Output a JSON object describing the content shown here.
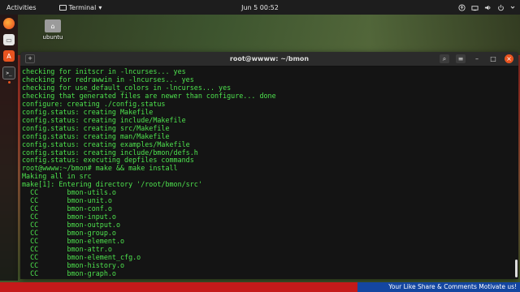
{
  "topbar": {
    "activities": "Activities",
    "app_name": "Terminal",
    "app_arrow": "▾",
    "clock": "Jun 5  00:52",
    "tray_icons": [
      "accessibility-icon",
      "network-icon",
      "volume-icon",
      "power-icon"
    ]
  },
  "dock": {
    "items": [
      "firefox-icon",
      "files-icon",
      "software-icon",
      "terminal-icon"
    ]
  },
  "desktop": {
    "home_label": "ubuntu"
  },
  "terminal": {
    "title": "root@wwww: ~/bmon",
    "lines": [
      "checking for initscr in -lncurses... yes",
      "checking for redrawwin in -lncurses... yes",
      "checking for use_default_colors in -lncurses... yes",
      "checking that generated files are newer than configure... done",
      "configure: creating ./config.status",
      "config.status: creating Makefile",
      "config.status: creating include/Makefile",
      "config.status: creating src/Makefile",
      "config.status: creating man/Makefile",
      "config.status: creating examples/Makefile",
      "config.status: creating include/bmon/defs.h",
      "config.status: executing depfiles commands",
      "root@wwww:~/bmon# make && make install",
      "Making all in src",
      "make[1]: Entering directory '/root/bmon/src'",
      "  CC       bmon-utils.o",
      "  CC       bmon-unit.o",
      "  CC       bmon-conf.o",
      "  CC       bmon-input.o",
      "  CC       bmon-output.o",
      "  CC       bmon-group.o",
      "  CC       bmon-element.o",
      "  CC       bmon-attr.o",
      "  CC       bmon-element_cfg.o",
      "  CC       bmon-history.o",
      "  CC       bmon-graph.o"
    ]
  },
  "banner": {
    "text": "Your Like Share & Comments Motivate us!"
  },
  "colors": {
    "terminal_text": "#4ee34e",
    "terminal_bg": "#141414",
    "ubuntu_orange": "#e95420",
    "banner_blue": "#1446a0",
    "banner_red": "#c41a1a"
  }
}
